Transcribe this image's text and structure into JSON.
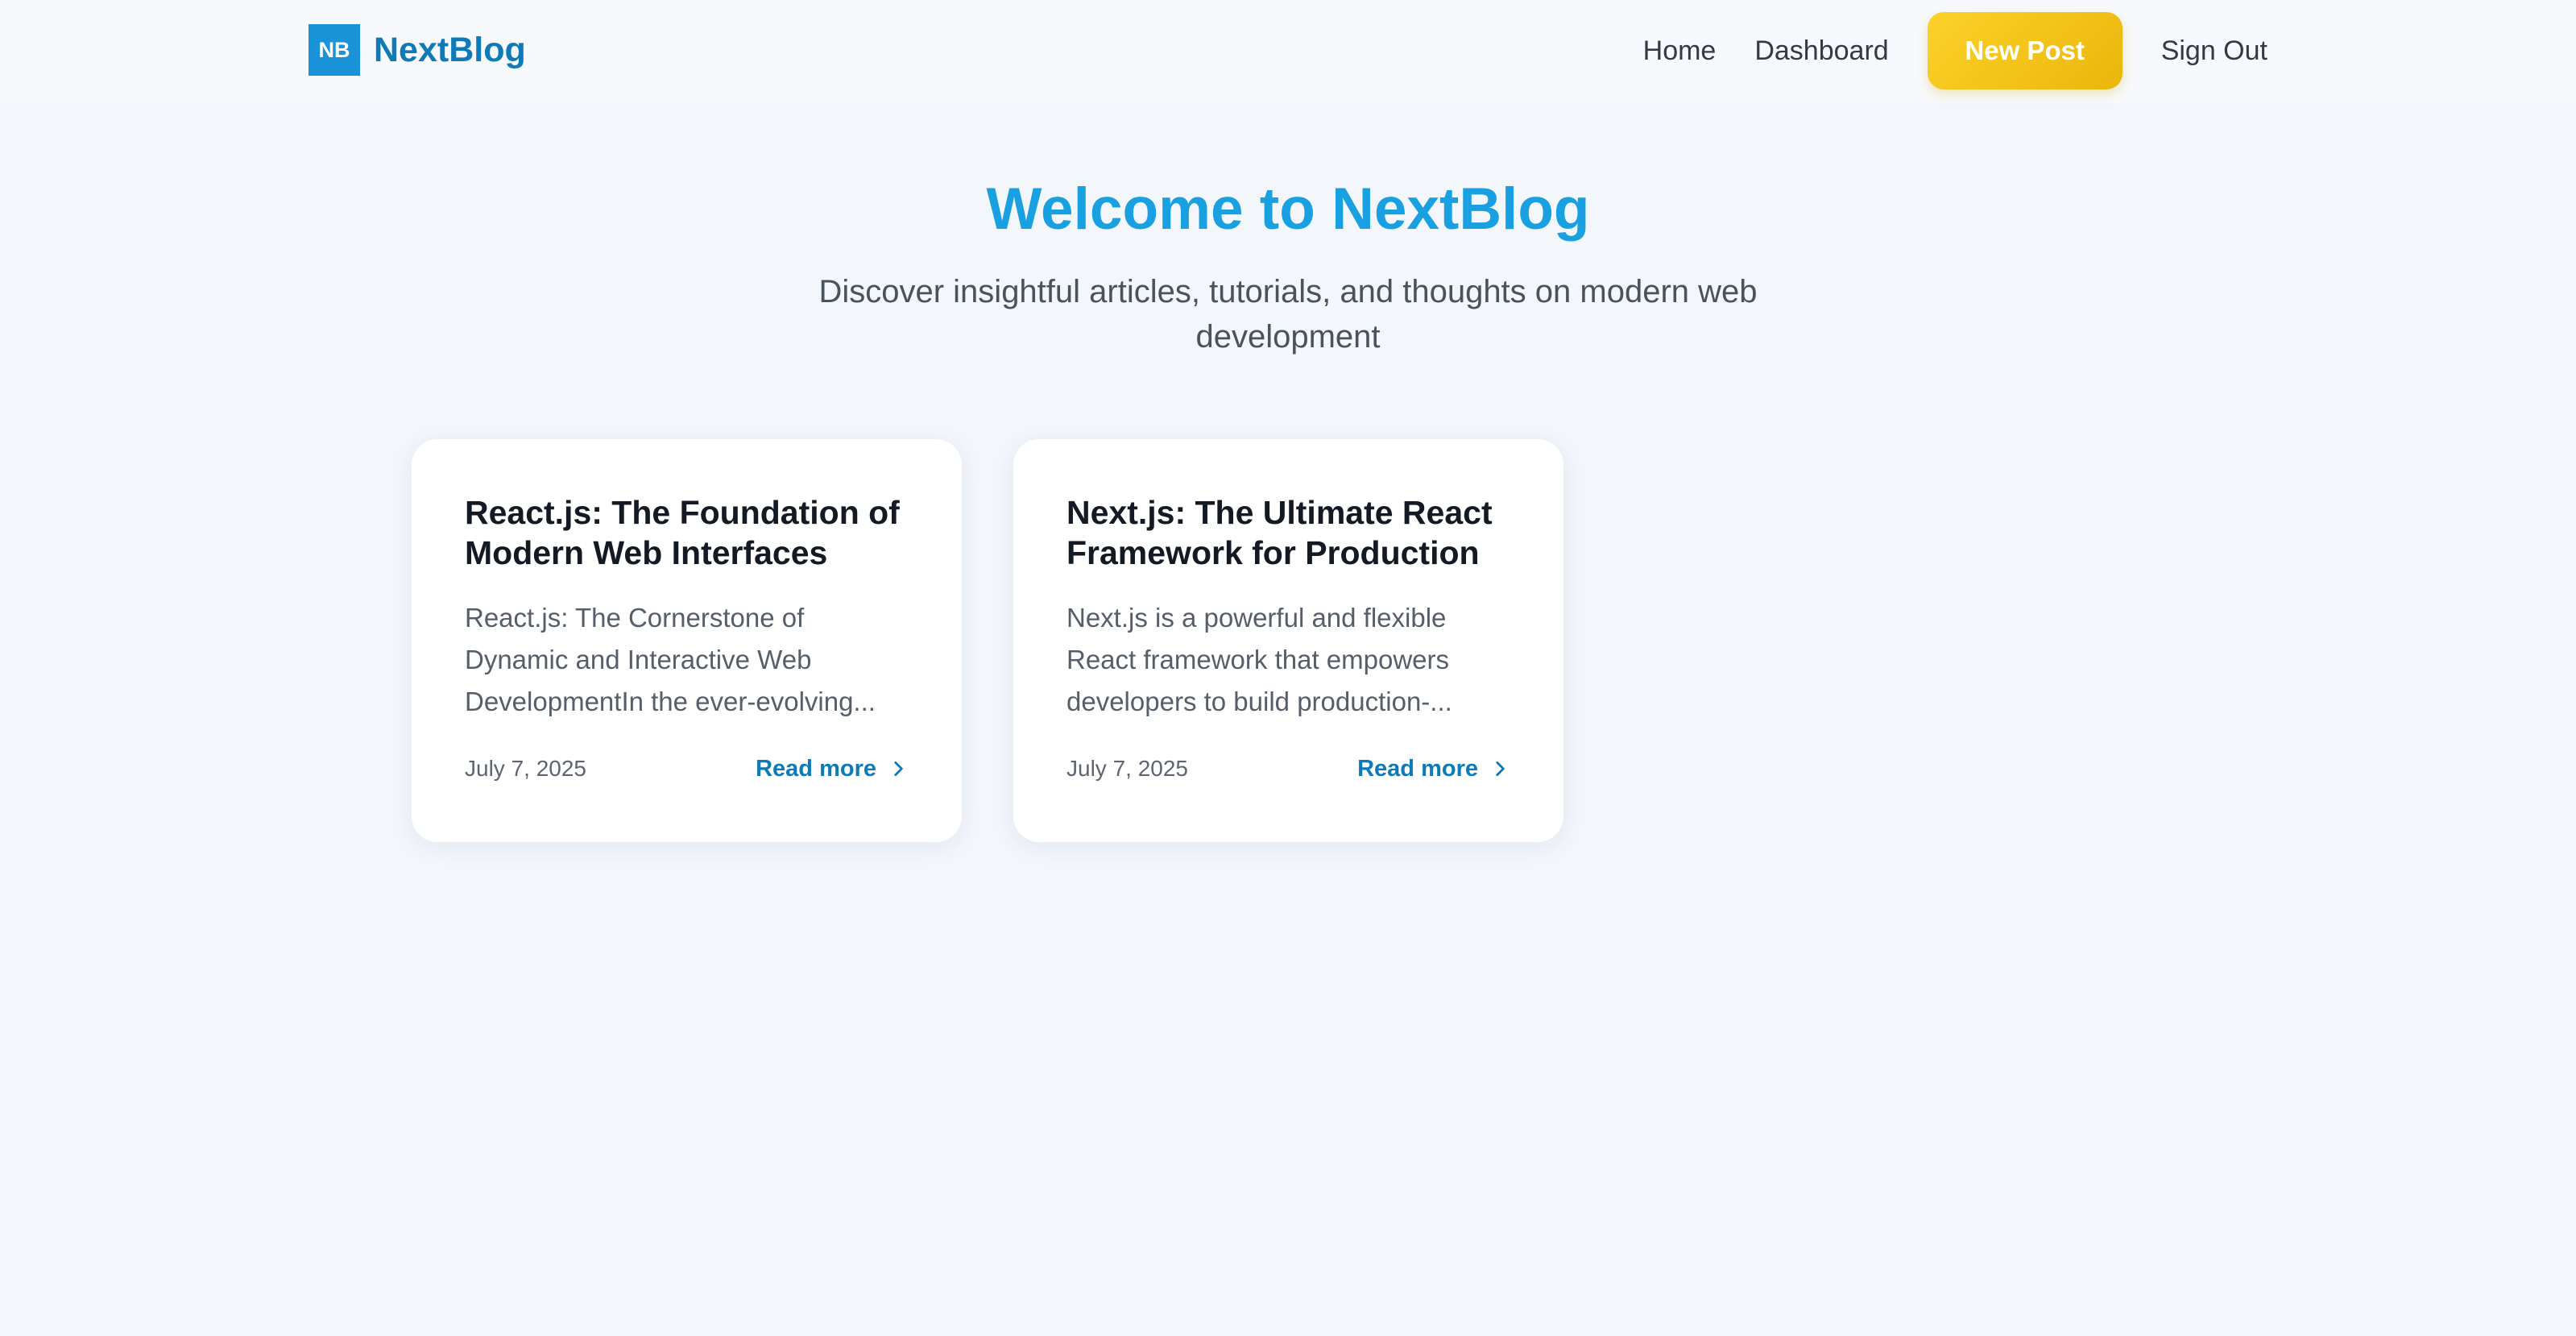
{
  "nav": {
    "logo_mark": "NB",
    "brand": "NextBlog",
    "links": [
      "Home",
      "Dashboard"
    ],
    "new_post": "New Post",
    "sign_out": "Sign Out"
  },
  "hero": {
    "title": "Welcome to NextBlog",
    "subtitle": "Discover insightful articles, tutorials, and thoughts on modern web development"
  },
  "posts": [
    {
      "title": "React.js: The Foundation of Modern Web Interfaces",
      "excerpt": "React.js: The Cornerstone of Dynamic and Interactive Web DevelopmentIn the ever-evolving...",
      "date": "July 7, 2025",
      "read_more": "Read more"
    },
    {
      "title": "Next.js: The Ultimate React Framework for Production",
      "excerpt": "Next.js is a powerful and flexible React framework that empowers developers to build production-...",
      "date": "July 7, 2025",
      "read_more": "Read more"
    }
  ],
  "colors": {
    "brand_blue": "#0f7ab8",
    "hero_blue": "#19a0e0",
    "accent_yellow": "#fcd22a"
  },
  "icons": {
    "read_more": "chevron-right-icon"
  }
}
